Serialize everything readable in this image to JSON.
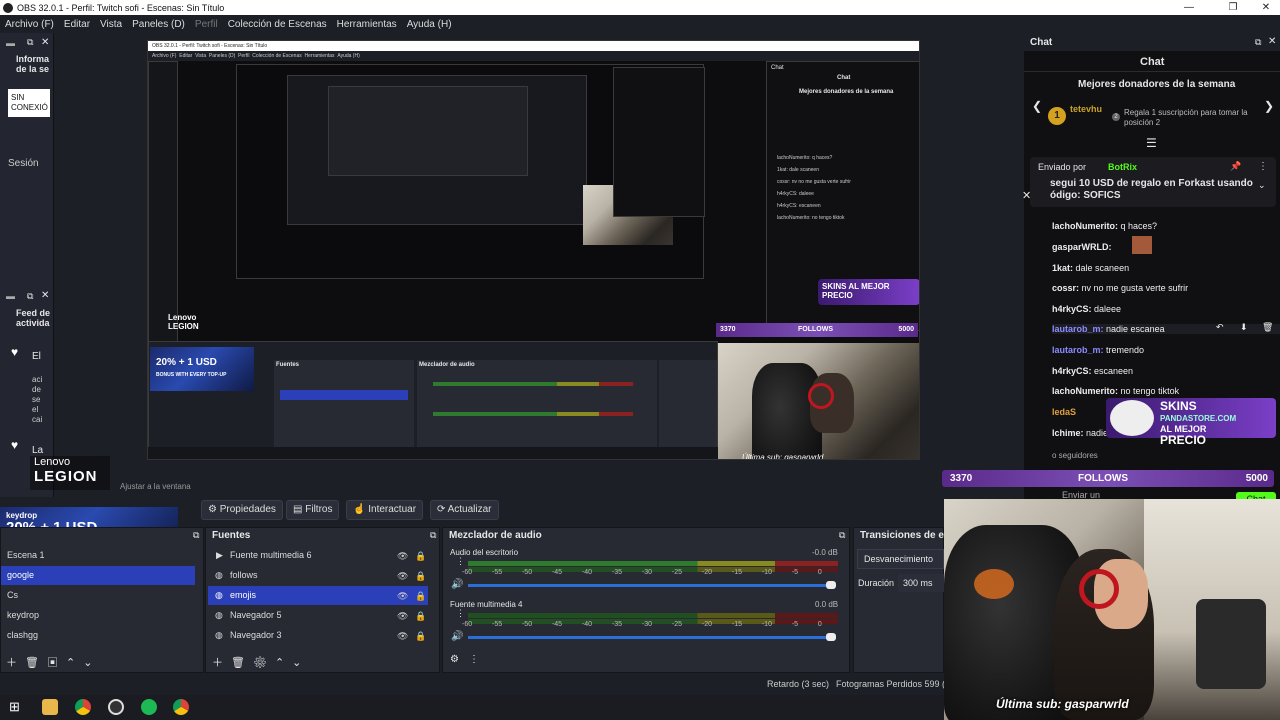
{
  "app": {
    "title": "OBS 32.0.1 - Perfil: Twitch sofi - Escenas: Sin Título"
  },
  "menu": [
    "Archivo (F)",
    "Editar",
    "Vista",
    "Paneles (D)",
    "Perfil",
    "Colección de Escenas",
    "Herramientas",
    "Ayuda (H)"
  ],
  "left_dock": {
    "title_top": "Informa de la se",
    "sin_conexion": "SIN CONEXIÓ",
    "sesion": "Sesión",
    "feed_title": "Feed de activida",
    "el": "El",
    "feed_text": [
      "aci",
      "de",
      "se",
      "el",
      "cai"
    ],
    "la": "La"
  },
  "lenovo": {
    "top": "Lenovo",
    "bottom": "LEGION"
  },
  "promo": {
    "main": "20% + 1 USD",
    "sub": "BONUS WITH EVERY TOP-UP",
    "brand": "keydrop"
  },
  "preview": {
    "inner_title": "OBS 32.0.1 - Perfil: Twitch sofi - Escenas: Sin Título",
    "adjust": "Ajustar a la ventana"
  },
  "toolbar": {
    "properties": "Propiedades",
    "filters": "Filtros",
    "interact": "Interactuar",
    "update": "Actualizar"
  },
  "scenes": {
    "items": [
      "Escena 1",
      "google",
      "Cs",
      "keydrop",
      "clashgg"
    ],
    "selected": "google"
  },
  "sources": {
    "title": "Fuentes",
    "items": [
      "Fuente multimedia 6",
      "follows",
      "emojis",
      "Navegador 5",
      "Navegador 3"
    ],
    "selected": "emojis"
  },
  "mixer": {
    "title": "Mezclador de audio",
    "channels": [
      {
        "name": "Audio del escritorio",
        "db": "-0.0 dB"
      },
      {
        "name": "Fuente multimedia 4",
        "db": "0.0 dB"
      }
    ],
    "ticks": [
      "-60",
      "-55",
      "-50",
      "-45",
      "-40",
      "-35",
      "-30",
      "-25",
      "-20",
      "-15",
      "-10",
      "-5",
      "0"
    ]
  },
  "transitions": {
    "title": "Transiciones de esc",
    "type": "Desvanecimiento",
    "duration_label": "Duración",
    "duration": "300 ms"
  },
  "status": {
    "delay": "Retardo (3 sec)",
    "frames": "Fotogramas Perdidos 599 (0"
  },
  "chat": {
    "dock_title": "Chat",
    "header": "Chat",
    "donors_title": "Mejores donadores de la semana",
    "donor_name": "tetevhu",
    "donor_rank": "1",
    "donor_rank2": "2",
    "donor_note": "Regala 1 suscripción para tomar la posición 2",
    "pinned_by": "Enviado por",
    "pinned_bot": "BotRix",
    "pinned_text": "segui 10 USD de regalo en Forkast usando ódigo: SOFICS",
    "messages": [
      {
        "user": "lachoNumerito:",
        "text": "q haces?",
        "color": "#e9e9e9"
      },
      {
        "user": "gasparWRLD:",
        "text": "",
        "color": "#e9e9e9"
      },
      {
        "user": "1kat:",
        "text": "dale scaneen",
        "color": "#e9e9e9"
      },
      {
        "user": "cossr:",
        "text": "nv no me gusta verte sufrir",
        "color": "#e9e9e9"
      },
      {
        "user": "h4rkyCS:",
        "text": "daleee",
        "color": "#e9e9e9"
      },
      {
        "user": "lautarob_m:",
        "text": "nadie escanea",
        "color": "#8b8bff"
      },
      {
        "user": "lautarob_m:",
        "text": "tremendo",
        "color": "#8b8bff"
      },
      {
        "user": "h4rkyCS:",
        "text": "escaneen",
        "color": "#e9e9e9"
      },
      {
        "user": "lachoNumerito:",
        "text": "no tengo tiktok",
        "color": "#e9e9e9"
      },
      {
        "user": "ledaS",
        "text": "",
        "color": "#e9e9e9"
      },
      {
        "user": "lchime:",
        "text": "nadie",
        "color": "#e9e9e9"
      }
    ],
    "followers": "o seguidores",
    "input_placeholder": "Enviar un",
    "send_button": "Chat"
  },
  "follows_banner": {
    "left": "3370",
    "center": "FOLLOWS",
    "right": "5000"
  },
  "skins_ad": {
    "line1": "SKINS",
    "line2": "AL MEJOR",
    "line3": "PRECIO",
    "site": "PANDASTORE.COM"
  },
  "webcam": {
    "caption": "Última sub: gasparwrld"
  },
  "colors": {
    "accent": "#2a3fb8",
    "bg": "#1d1f26",
    "meter_green": "#2f7a2f",
    "meter_yellow": "#8a8a22",
    "meter_red": "#8a2222",
    "banner": "#7b4fb5"
  }
}
